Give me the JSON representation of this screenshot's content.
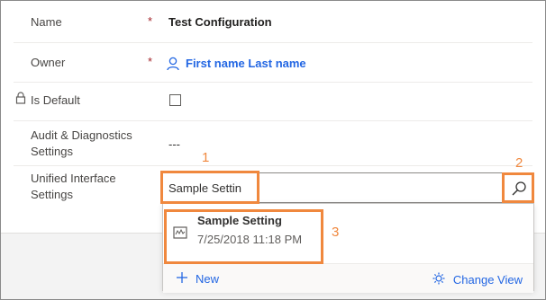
{
  "form": {
    "name_label": "Name",
    "name_value": "Test Configuration",
    "owner_label": "Owner",
    "owner_value": "First name Last name",
    "required_mark": "*",
    "is_default_label": "Is Default",
    "audit_label_line1": "Audit & Diagnostics",
    "audit_label_line2": "Settings",
    "audit_value": "---",
    "uis_label_line1": "Unified Interface",
    "uis_label_line2": "Settings"
  },
  "lookup": {
    "input_value": "Sample Settin",
    "result_title": "Sample Setting",
    "result_subtitle": "7/25/2018 11:18 PM",
    "new_label": "New",
    "change_view_label": "Change View"
  },
  "annotations": {
    "one": "1",
    "two": "2",
    "three": "3",
    "color": "#f0883e"
  },
  "colors": {
    "link": "#2266e3",
    "required": "#a4262c"
  }
}
